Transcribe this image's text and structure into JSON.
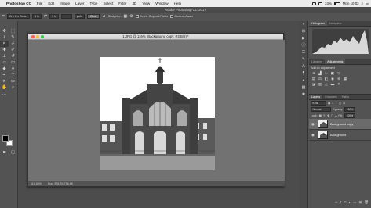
{
  "menubar": {
    "apple": "",
    "app": "Photoshop CC",
    "items": [
      "File",
      "Edit",
      "Image",
      "Layer",
      "Type",
      "Select",
      "Filter",
      "3D",
      "View",
      "Window",
      "Help"
    ],
    "battery": "33%",
    "clock": "Mon 10:02"
  },
  "app_title": "Adobe Photoshop CC 2017",
  "options": {
    "ratio": "W x H x Reso..",
    "width": "8 in",
    "height": "7 in",
    "resolution": "",
    "unit": "px/in",
    "clear": "Clear",
    "straighten": "Straighten",
    "delete_cropped": "Delete Cropped Pixels",
    "content_aware": "Content-Aware"
  },
  "document": {
    "title": "1.JPG @ 116% (Background copy, RGB/8) *",
    "zoom": "116.88%",
    "doc_info": "Doc: 378.7K/756.6K"
  },
  "panels": {
    "top_tabs": [
      "Histogram",
      "Navigator"
    ],
    "mid_tabs": [
      "Libraries",
      "Adjustments"
    ],
    "add_adjustment": "Add an adjustment",
    "layer_tabs": [
      "Layers",
      "Channels",
      "Paths"
    ],
    "kind": "Kind",
    "blend": "Normal",
    "opacity_label": "Opacity:",
    "opacity": "100%",
    "lock_label": "Lock:",
    "fill_label": "Fill:",
    "fill": "100%",
    "layers": [
      {
        "name": "Background copy",
        "selected": true
      },
      {
        "name": "Background",
        "selected": false
      }
    ]
  },
  "colors": {
    "foreground": "#000000",
    "background": "#ffffff",
    "close": "#fc605c",
    "minimize": "#fdbc40",
    "maximize": "#34c84a"
  },
  "icons": {
    "tools": [
      "move-icon",
      "marquee-icon",
      "lasso-icon",
      "quick-select-icon",
      "crop-icon",
      "eyedropper-icon",
      "healing-icon",
      "brush-icon",
      "stamp-icon",
      "history-brush-icon",
      "eraser-icon",
      "gradient-icon",
      "blur-icon",
      "dodge-icon",
      "pen-icon",
      "type-icon",
      "path-select-icon",
      "rectangle-icon",
      "hand-icon",
      "zoom-icon"
    ]
  }
}
